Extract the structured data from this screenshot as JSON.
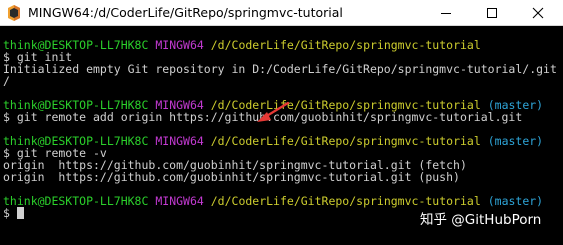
{
  "window": {
    "title": "MINGW64:/d/CoderLife/GitRepo/springmvc-tutorial"
  },
  "terminal": {
    "blocks": [
      {
        "prompt": {
          "user": "think@DESKTOP-LL7HK8C",
          "system": "MINGW64",
          "path": "/d/CoderLife/GitRepo/springmvc-tutorial",
          "branch": ""
        },
        "command": "$ git init",
        "output": [
          "Initialized empty Git repository in D:/CoderLife/GitRepo/springmvc-tutorial/.git",
          "/"
        ]
      },
      {
        "prompt": {
          "user": "think@DESKTOP-LL7HK8C",
          "system": "MINGW64",
          "path": "/d/CoderLife/GitRepo/springmvc-tutorial",
          "branch": "(master)"
        },
        "command": "$ git remote add origin https://github.com/guobinhit/springmvc-tutorial.git",
        "output": []
      },
      {
        "prompt": {
          "user": "think@DESKTOP-LL7HK8C",
          "system": "MINGW64",
          "path": "/d/CoderLife/GitRepo/springmvc-tutorial",
          "branch": "(master)"
        },
        "command": "$ git remote -v",
        "output": [
          "origin  https://github.com/guobinhit/springmvc-tutorial.git (fetch)",
          "origin  https://github.com/guobinhit/springmvc-tutorial.git (push)"
        ]
      },
      {
        "prompt": {
          "user": "think@DESKTOP-LL7HK8C",
          "system": "MINGW64",
          "path": "/d/CoderLife/GitRepo/springmvc-tutorial",
          "branch": "(master)"
        },
        "command": "$ ",
        "output": []
      }
    ]
  },
  "watermark": {
    "text": "知乎 @GitHubPorn"
  },
  "colors": {
    "user": "#2bcf2b",
    "system": "#c23ad1",
    "path": "#cdcd2e",
    "branch": "#2ea5d8",
    "text": "#d0d0d0",
    "arrow": "#e53935"
  }
}
